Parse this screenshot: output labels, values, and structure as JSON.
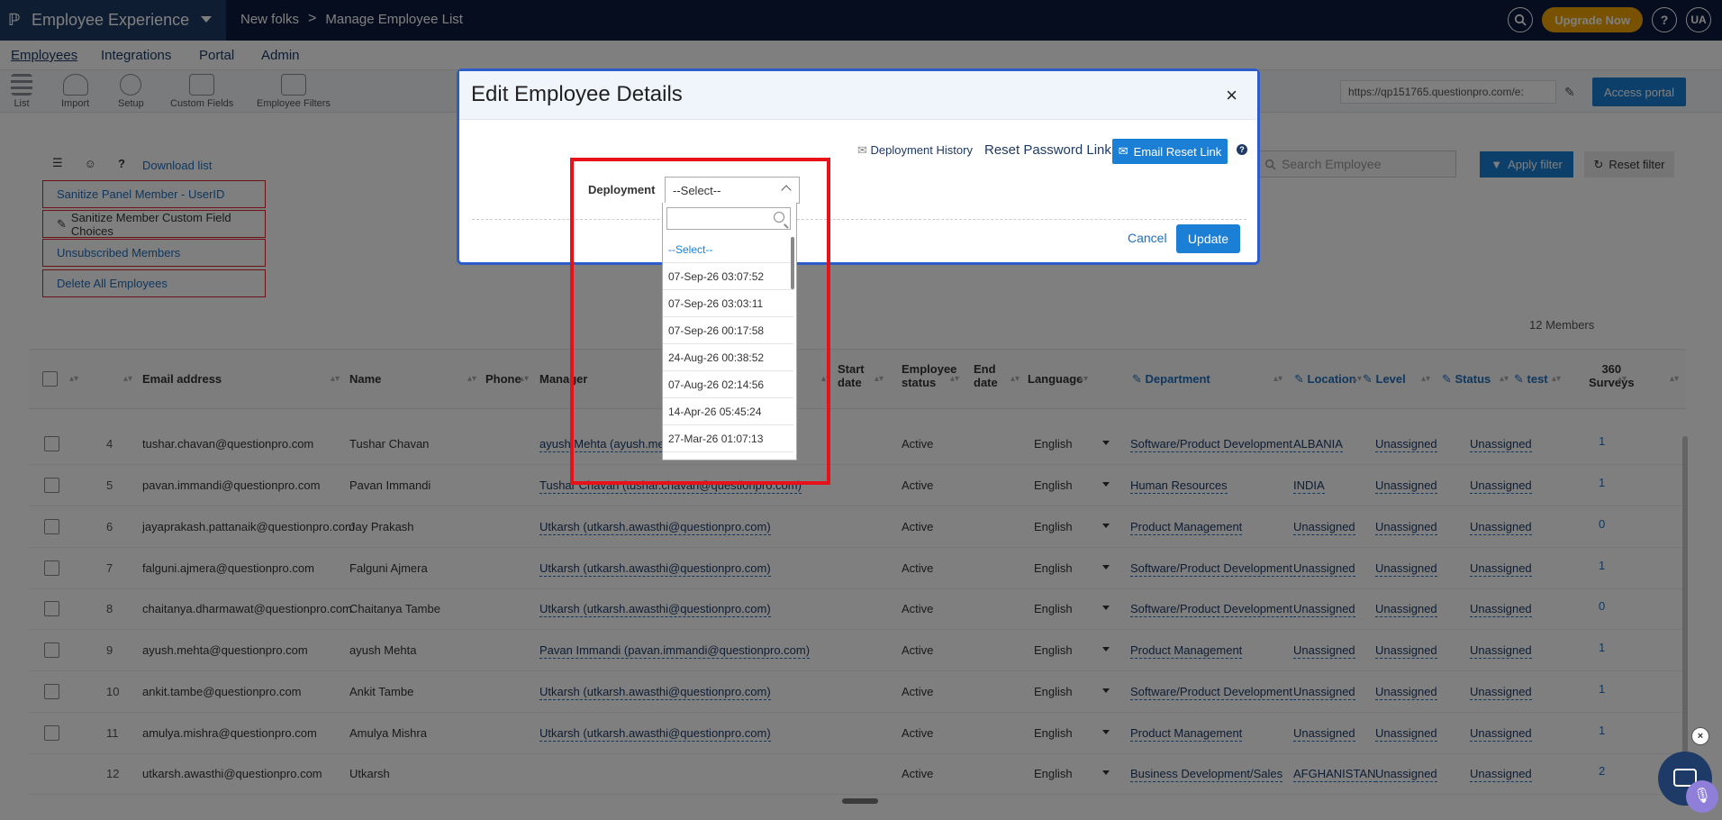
{
  "header": {
    "app_name": "Employee Experience",
    "crumb_1": "New folks",
    "crumb_sep": ">",
    "crumb_2": "Manage Employee List",
    "upgrade_label": "Upgrade Now",
    "help_label": "?",
    "user_initials": "UA"
  },
  "subnav": [
    "Employees",
    "Integrations",
    "Portal",
    "Admin"
  ],
  "toolbar": {
    "tools": [
      "List",
      "Import",
      "Setup",
      "Custom Fields",
      "Employee Filters"
    ],
    "portal_url": "https://qp151765.questionpro.com/e:",
    "access_portal_label": "Access portal"
  },
  "left_panel": {
    "download_label": "Download list",
    "actions": [
      "Sanitize Panel Member - UserID",
      "Sanitize Member Custom Field Choices",
      "Unsubscribed Members",
      "Delete All Employees"
    ]
  },
  "filters": {
    "search_placeholder": "Search Employee",
    "apply_label": "Apply filter",
    "reset_label": "Reset filter"
  },
  "members_count": "12 Members",
  "table": {
    "headers": {
      "email": "Email address",
      "name": "Name",
      "phone": "Phone",
      "manager": "Manager",
      "start_date_1": "Start",
      "start_date_2": "date",
      "emp_status_1": "Employee",
      "emp_status_2": "status",
      "end_date_1": "End",
      "end_date_2": "date",
      "language": "Language",
      "department": "Department",
      "location": "Location",
      "level": "Level",
      "status": "Status",
      "test": "test",
      "surveys_1": "360",
      "surveys_2": "Surveys"
    },
    "rows": [
      {
        "num": "4",
        "email": "tushar.chavan@questionpro.com",
        "name": "Tushar Chavan",
        "manager": "ayush Mehta (ayush.meh",
        "emp_status": "Active",
        "language": "English",
        "department": "Software/Product Development",
        "location": "ALBANIA",
        "level": "Unassigned",
        "status": "Unassigned",
        "surveys": "1"
      },
      {
        "num": "5",
        "email": "pavan.immandi@questionpro.com",
        "name": "Pavan Immandi",
        "manager": "Tushar Chavan (tushar.chavan@questionpro.com)",
        "emp_status": "Active",
        "language": "English",
        "department": "Human Resources",
        "location": "INDIA",
        "level": "Unassigned",
        "status": "Unassigned",
        "surveys": "1"
      },
      {
        "num": "6",
        "email": "jayaprakash.pattanaik@questionpro.com",
        "name": "Jay Prakash",
        "manager": "Utkarsh (utkarsh.awasthi@questionpro.com)",
        "emp_status": "Active",
        "language": "English",
        "department": "Product Management",
        "location": "Unassigned",
        "level": "Unassigned",
        "status": "Unassigned",
        "surveys": "0"
      },
      {
        "num": "7",
        "email": "falguni.ajmera@questionpro.com",
        "name": "Falguni Ajmera",
        "manager": "Utkarsh (utkarsh.awasthi@questionpro.com)",
        "emp_status": "Active",
        "language": "English",
        "department": "Software/Product Development",
        "location": "Unassigned",
        "level": "Unassigned",
        "status": "Unassigned",
        "surveys": "1"
      },
      {
        "num": "8",
        "email": "chaitanya.dharmawat@questionpro.com",
        "name": "Chaitanya Tambe",
        "manager": "Utkarsh (utkarsh.awasthi@questionpro.com)",
        "emp_status": "Active",
        "language": "English",
        "department": "Software/Product Development",
        "location": "Unassigned",
        "level": "Unassigned",
        "status": "Unassigned",
        "surveys": "0"
      },
      {
        "num": "9",
        "email": "ayush.mehta@questionpro.com",
        "name": "ayush Mehta",
        "manager": "Pavan Immandi (pavan.immandi@questionpro.com)",
        "emp_status": "Active",
        "language": "English",
        "department": "Product Management",
        "location": "Unassigned",
        "level": "Unassigned",
        "status": "Unassigned",
        "surveys": "1"
      },
      {
        "num": "10",
        "email": "ankit.tambe@questionpro.com",
        "name": "Ankit Tambe",
        "manager": "Utkarsh (utkarsh.awasthi@questionpro.com)",
        "emp_status": "Active",
        "language": "English",
        "department": "Software/Product Development",
        "location": "Unassigned",
        "level": "Unassigned",
        "status": "Unassigned",
        "surveys": "1"
      },
      {
        "num": "11",
        "email": "amulya.mishra@questionpro.com",
        "name": "Amulya Mishra",
        "manager": "Utkarsh (utkarsh.awasthi@questionpro.com)",
        "emp_status": "Active",
        "language": "English",
        "department": "Product Management",
        "location": "Unassigned",
        "level": "Unassigned",
        "status": "Unassigned",
        "surveys": "1"
      },
      {
        "num": "12",
        "email": "utkarsh.awasthi@questionpro.com",
        "name": "Utkarsh",
        "manager": "",
        "emp_status": "Active",
        "language": "English",
        "department": "Business Development/Sales",
        "location": "AFGHANISTAN",
        "level": "Unassigned",
        "status": "Unassigned",
        "surveys": "2"
      }
    ]
  },
  "modal": {
    "title": "Edit Employee Details",
    "close_glyph": "×",
    "deployment_history_label": "Deployment History",
    "reset_password_label": "Reset Password Link",
    "email_reset_label": "Email Reset Link",
    "deployment_label": "Deployment",
    "select_value": "--Select--",
    "cancel_label": "Cancel",
    "update_label": "Update",
    "options": [
      "--Select--",
      "07-Sep-26 03:07:52",
      "07-Sep-26 03:03:11",
      "07-Sep-26 00:17:58",
      "24-Aug-26 00:38:52",
      "07-Aug-26 02:14:56",
      "14-Apr-26 05:45:24",
      "27-Mar-26 01:07:13"
    ]
  },
  "colors": {
    "header_bg": "#0d1b3d",
    "primary_button": "#1b7fd6",
    "link": "#1e6fbf",
    "highlight_border": "#e8111a",
    "upgrade": "#f0a500"
  }
}
